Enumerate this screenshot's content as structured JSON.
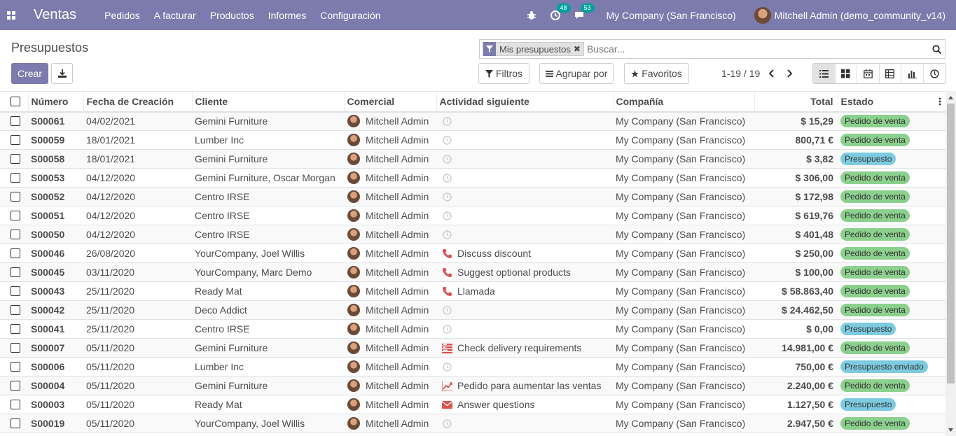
{
  "navbar": {
    "app_name": "Ventas",
    "menu": [
      "Pedidos",
      "A facturar",
      "Productos",
      "Informes",
      "Configuración"
    ],
    "activity_count": "48",
    "messages_count": "53",
    "company": "My Company (San Francisco)",
    "user": "Mitchell Admin (demo_community_v14)",
    "icons": [
      "apps-icon",
      "bug-icon",
      "activity-clock-icon",
      "chat-icon"
    ],
    "color": "#7c7bad"
  },
  "control_panel": {
    "title": "Presupuestos",
    "create_label": "Crear",
    "search": {
      "facet_label": "Mis presupuestos",
      "placeholder": "Buscar..."
    },
    "filters_label": "Filtros",
    "group_by_label": "Agrupar por",
    "favorites_label": "Favoritos",
    "pager": "1-19 / 19"
  },
  "table": {
    "columns": [
      "Número",
      "Fecha de Creación",
      "Cliente",
      "Comercial",
      "Actividad siguiente",
      "Compañía",
      "Total",
      "Estado"
    ],
    "rows": [
      {
        "number": "S00061",
        "date": "04/02/2021",
        "customer": "Gemini Furniture",
        "salesperson": "Mitchell Admin",
        "activity": "",
        "activity_icon": "clock",
        "company": "My Company (San Francisco)",
        "total": "$ 15,29",
        "state": "Pedido de venta",
        "state_type": "sale"
      },
      {
        "number": "S00059",
        "date": "18/01/2021",
        "customer": "Lumber Inc",
        "salesperson": "Mitchell Admin",
        "activity": "",
        "activity_icon": "clock",
        "company": "My Company (San Francisco)",
        "total": "800,71 €",
        "state": "Pedido de venta",
        "state_type": "sale"
      },
      {
        "number": "S00058",
        "date": "18/01/2021",
        "customer": "Gemini Furniture",
        "salesperson": "Mitchell Admin",
        "activity": "",
        "activity_icon": "clock",
        "company": "My Company (San Francisco)",
        "total": "$ 3,82",
        "state": "Presupuesto",
        "state_type": "quote"
      },
      {
        "number": "S00053",
        "date": "04/12/2020",
        "customer": "Gemini Furniture, Oscar Morgan",
        "salesperson": "Mitchell Admin",
        "activity": "",
        "activity_icon": "clock",
        "company": "My Company (San Francisco)",
        "total": "$ 306,00",
        "state": "Pedido de venta",
        "state_type": "sale"
      },
      {
        "number": "S00052",
        "date": "04/12/2020",
        "customer": "Centro IRSE",
        "salesperson": "Mitchell Admin",
        "activity": "",
        "activity_icon": "clock",
        "company": "My Company (San Francisco)",
        "total": "$ 172,98",
        "state": "Pedido de venta",
        "state_type": "sale"
      },
      {
        "number": "S00051",
        "date": "04/12/2020",
        "customer": "Centro IRSE",
        "salesperson": "Mitchell Admin",
        "activity": "",
        "activity_icon": "clock",
        "company": "My Company (San Francisco)",
        "total": "$ 619,76",
        "state": "Pedido de venta",
        "state_type": "sale"
      },
      {
        "number": "S00050",
        "date": "04/12/2020",
        "customer": "Centro IRSE",
        "salesperson": "Mitchell Admin",
        "activity": "",
        "activity_icon": "clock",
        "company": "My Company (San Francisco)",
        "total": "$ 401,48",
        "state": "Pedido de venta",
        "state_type": "sale"
      },
      {
        "number": "S00046",
        "date": "26/08/2020",
        "customer": "YourCompany, Joel Willis",
        "salesperson": "Mitchell Admin",
        "activity": "Discuss discount",
        "activity_icon": "phone",
        "company": "My Company (San Francisco)",
        "total": "$ 250,00",
        "state": "Pedido de venta",
        "state_type": "sale"
      },
      {
        "number": "S00045",
        "date": "03/11/2020",
        "customer": "YourCompany, Marc Demo",
        "salesperson": "Mitchell Admin",
        "activity": "Suggest optional products",
        "activity_icon": "phone",
        "company": "My Company (San Francisco)",
        "total": "$ 100,00",
        "state": "Pedido de venta",
        "state_type": "sale"
      },
      {
        "number": "S00043",
        "date": "25/11/2020",
        "customer": "Ready Mat",
        "salesperson": "Mitchell Admin",
        "activity": "Llamada",
        "activity_icon": "phone",
        "company": "My Company (San Francisco)",
        "total": "$ 58.863,40",
        "state": "Pedido de venta",
        "state_type": "sale"
      },
      {
        "number": "S00042",
        "date": "25/11/2020",
        "customer": "Deco Addict",
        "salesperson": "Mitchell Admin",
        "activity": "",
        "activity_icon": "clock",
        "company": "My Company (San Francisco)",
        "total": "$ 24.462,50",
        "state": "Pedido de venta",
        "state_type": "sale"
      },
      {
        "number": "S00041",
        "date": "25/11/2020",
        "customer": "Centro IRSE",
        "salesperson": "Mitchell Admin",
        "activity": "",
        "activity_icon": "clock",
        "company": "My Company (San Francisco)",
        "total": "$ 0,00",
        "state": "Presupuesto",
        "state_type": "quote"
      },
      {
        "number": "S00007",
        "date": "05/11/2020",
        "customer": "Gemini Furniture",
        "salesperson": "Mitchell Admin",
        "activity": "Check delivery requirements",
        "activity_icon": "tasks",
        "company": "My Company (San Francisco)",
        "total": "14.981,00 €",
        "state": "Pedido de venta",
        "state_type": "sale"
      },
      {
        "number": "S00006",
        "date": "05/11/2020",
        "customer": "Lumber Inc",
        "salesperson": "Mitchell Admin",
        "activity": "",
        "activity_icon": "clock",
        "company": "My Company (San Francisco)",
        "total": "750,00 €",
        "state": "Presupuesto enviado",
        "state_type": "sent"
      },
      {
        "number": "S00004",
        "date": "05/11/2020",
        "customer": "Gemini Furniture",
        "salesperson": "Mitchell Admin",
        "activity": "Pedido para aumentar las ventas",
        "activity_icon": "chart",
        "company": "My Company (San Francisco)",
        "total": "2.240,00 €",
        "state": "Pedido de venta",
        "state_type": "sale"
      },
      {
        "number": "S00003",
        "date": "05/11/2020",
        "customer": "Ready Mat",
        "salesperson": "Mitchell Admin",
        "activity": "Answer questions",
        "activity_icon": "envelope",
        "company": "My Company (San Francisco)",
        "total": "1.127,50 €",
        "state": "Presupuesto",
        "state_type": "quote"
      },
      {
        "number": "S00019",
        "date": "05/11/2020",
        "customer": "YourCompany, Joel Willis",
        "salesperson": "Mitchell Admin",
        "activity": "",
        "activity_icon": "clock",
        "company": "My Company (San Francisco)",
        "total": "2.947,50 €",
        "state": "Pedido de venta",
        "state_type": "sale"
      }
    ]
  }
}
